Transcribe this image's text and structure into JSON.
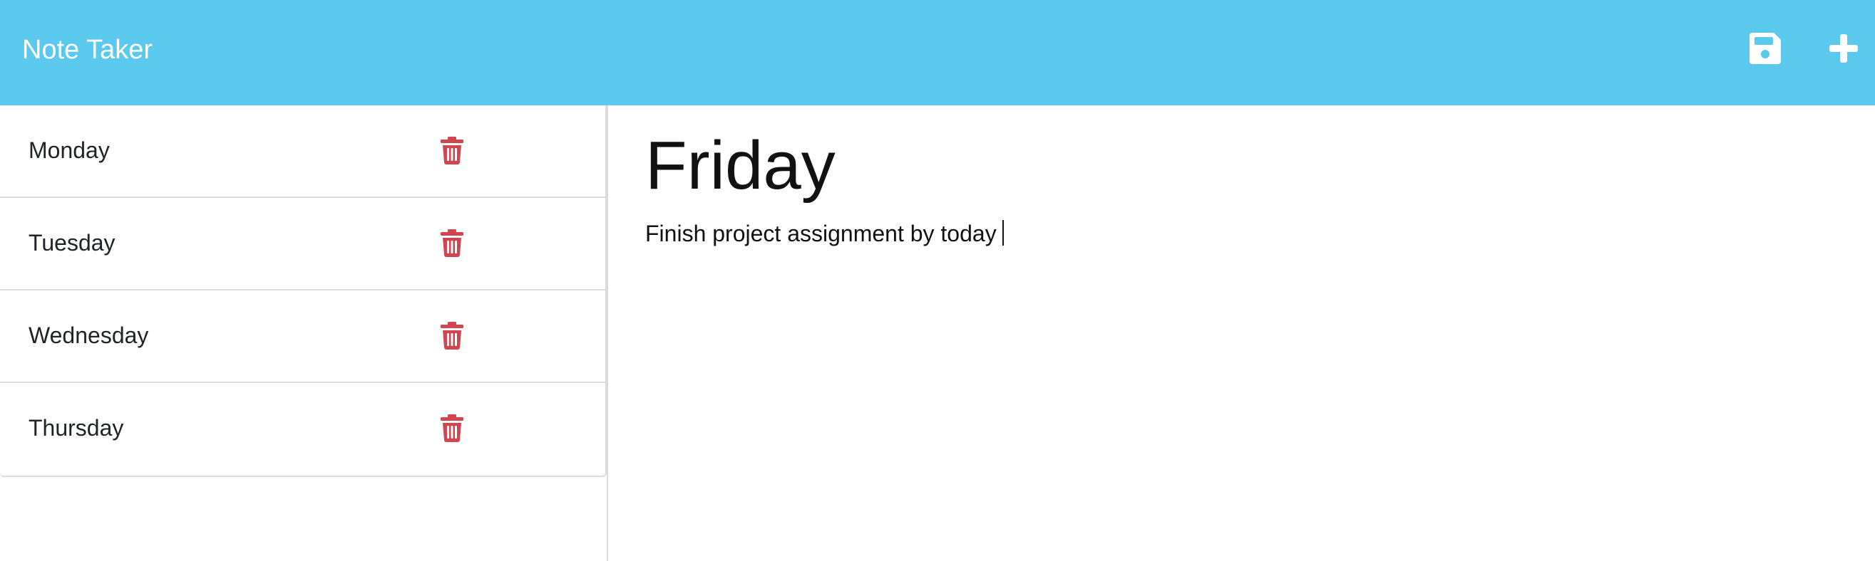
{
  "app": {
    "title": "Note Taker",
    "accent_color": "#5bc8ee",
    "delete_color": "#d0454f"
  },
  "toolbar": {
    "save_icon": "floppy-disk-icon",
    "new_icon": "plus-icon"
  },
  "notes": [
    {
      "title": "Monday",
      "delete_icon": "trash-icon"
    },
    {
      "title": "Tuesday",
      "delete_icon": "trash-icon"
    },
    {
      "title": "Wednesday",
      "delete_icon": "trash-icon"
    },
    {
      "title": "Thursday",
      "delete_icon": "trash-icon"
    }
  ],
  "editor": {
    "title": "Friday",
    "text": "Finish project assignment by today"
  }
}
